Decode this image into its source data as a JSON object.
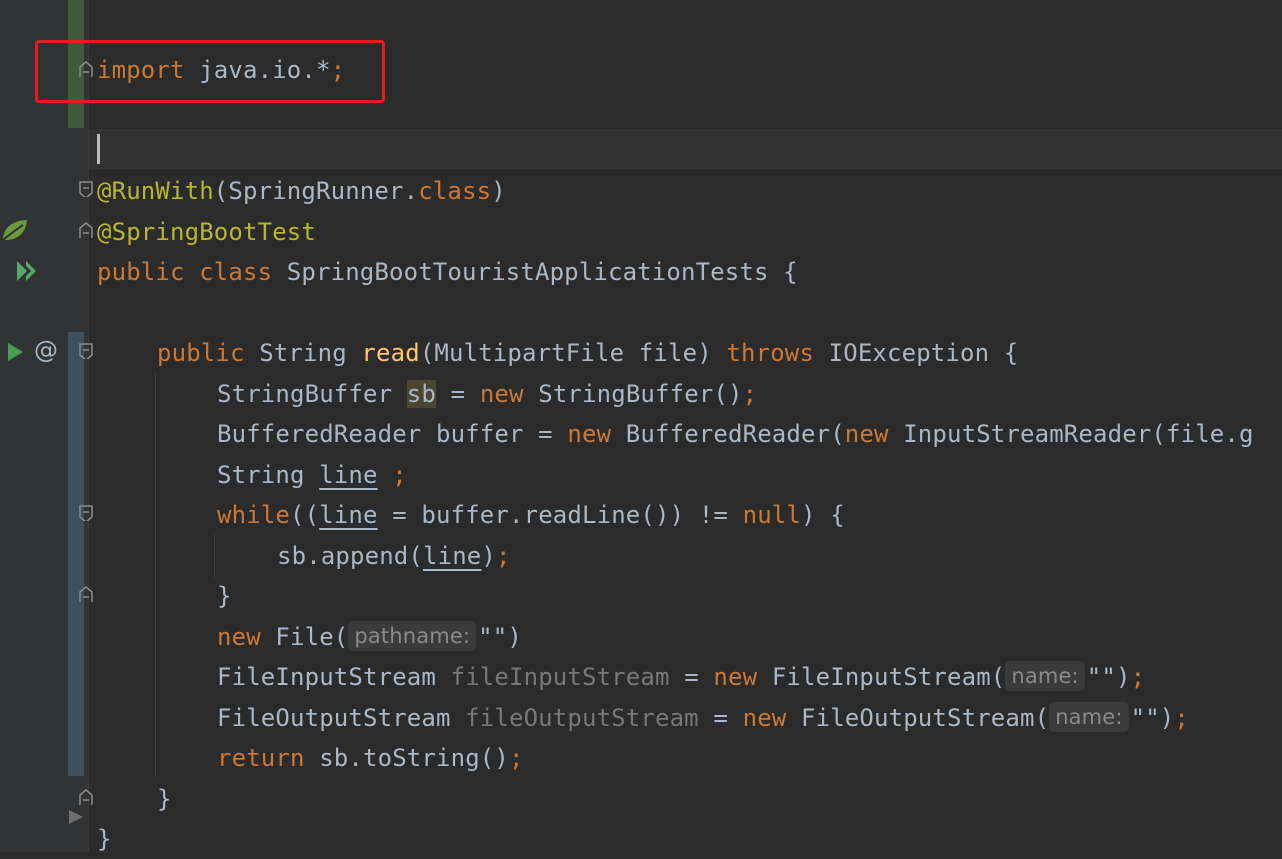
{
  "editor": {
    "theme_colors": {
      "background": "#2b2b2b",
      "keyword": "#cc7832",
      "annotation": "#bbb529",
      "method_declaration": "#ffc66d",
      "plain": "#a9b7c6",
      "unused_variable": "#787878",
      "highlight_box": "#e0201c"
    },
    "gutter_icons": [
      "spring-bean-icon",
      "run-gutter-icon",
      "run-test-icon",
      "override-annotation-icon",
      "fold-icon"
    ],
    "code": {
      "import_kw": "import",
      "import_pkg": " java.io.*",
      "import_semi": ";",
      "runwith_ann": "@RunWith",
      "runwith_open": "(SpringRunner.",
      "runwith_class_kw": "class",
      "runwith_close": ")",
      "springboot_ann": "@SpringBootTest",
      "class_kw": "public class",
      "class_name": " SpringBootTouristApplicationTests {",
      "read_kw": "public",
      "read_type": " String ",
      "read_name": "read",
      "read_params": "(MultipartFile file) ",
      "read_throws": "throws",
      "read_exc": " IOException {",
      "sb_type": "StringBuffer ",
      "sb_var": "sb",
      "sb_eq": " = ",
      "sb_new": "new",
      "sb_ctor": " StringBuffer()",
      "sb_semi": ";",
      "buf_decl": "BufferedReader buffer = ",
      "buf_new1": "new",
      "buf_ctor1": " BufferedReader(",
      "buf_new2": "new",
      "buf_ctor2": " InputStreamReader(file.g",
      "line_type": "String ",
      "line_var": "line",
      "line_semi": " ;",
      "while_kw": "while",
      "while_open": "((",
      "while_var": "line",
      "while_mid": " = buffer.readLine()) != ",
      "while_null": "null",
      "while_close": ") {",
      "append_pre": "sb.append(",
      "append_var": "line",
      "append_close": ")",
      "append_semi": ";",
      "close_brace_inner": "}",
      "file_new": "new",
      "file_ctor": " File(",
      "file_hint": "pathname:",
      "file_arg": "\"\")",
      "fis_type": "FileInputStream ",
      "fis_var": "fileInputStream",
      "fis_eq": " = ",
      "fis_new": "new",
      "fis_ctor": " FileInputStream(",
      "fis_hint": "name:",
      "fis_arg": "\"\")",
      "fis_semi": ";",
      "fos_type": "FileOutputStream ",
      "fos_var": "fileOutputStream",
      "fos_eq": " = ",
      "fos_new": "new",
      "fos_ctor": " FileOutputStream(",
      "fos_hint": "name:",
      "fos_arg": "\"\")",
      "fos_semi": ";",
      "return_kw": "return",
      "return_expr": " sb.toString()",
      "return_semi": ";",
      "method_close": "}",
      "class_close": "}"
    }
  }
}
